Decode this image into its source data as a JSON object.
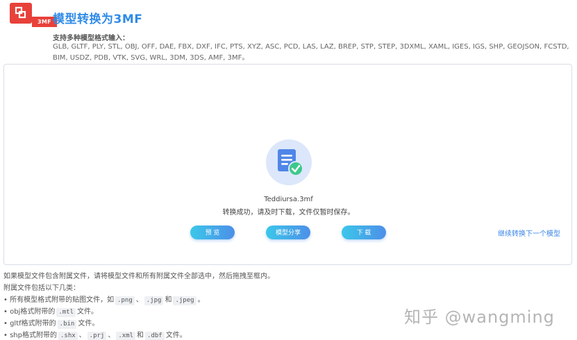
{
  "header": {
    "logo_tag": "3MF",
    "title": "模型转换为3MF"
  },
  "formats": {
    "label": "支持多种模型格式输入：",
    "list": "GLB, GLTF, PLY, STL, OBJ, OFF, DAE, FBX, DXF, IFC, PTS, XYZ, ASC, PCD, LAS, LAZ, BREP, STP, STEP, 3DXML, XAML, IGES, IGS, SHP, GEOJSON, FCSTD, BIM, USDZ, PDB, VTK, SVG, WRL, 3DM, 3DS, AMF, 3MF。"
  },
  "result": {
    "file_name": "Teddiursa.3mf",
    "status": "转换成功，请及时下载，文件仅暂时保存。",
    "preview_label": "预  览",
    "share_label": "模型分享",
    "download_label": "下  载",
    "continue_label": "继续转换下一个模型"
  },
  "notes": {
    "line1": "如果模型文件包含附属文件，请将模型文件和所有附属文件全部选中，然后拖拽至框内。",
    "line2": "附属文件包括以下几类：",
    "line3_prefix": "• 所有模型格式附带的贴图文件，如",
    "line3_png": ".png",
    "line3_sep1": "、",
    "line3_jpg": ".jpg",
    "line3_and": "和",
    "line3_jpeg": ".jpeg",
    "line3_end": "。",
    "line4_prefix": "• obj格式附带的",
    "line4_mtl": ".mtl",
    "line4_end": "文件。",
    "line5_prefix": "• gltf格式附带的",
    "line5_bin": ".bin",
    "line5_end": "文件。",
    "line6_prefix": "• shp格式附带的",
    "line6_shx": ".shx",
    "line6_sep1": "、",
    "line6_prj": ".prj",
    "line6_sep2": "、",
    "line6_xml": ".xml",
    "line6_and": "和",
    "line6_dbf": ".dbf",
    "line6_end": "文件。"
  },
  "watermark": "知乎 @wangming",
  "colors": {
    "accent": "#2f8be8",
    "logo": "#e8413a",
    "button_start": "#3bc7e9",
    "button_end": "#4d8fe8",
    "success": "#3cc98a"
  }
}
